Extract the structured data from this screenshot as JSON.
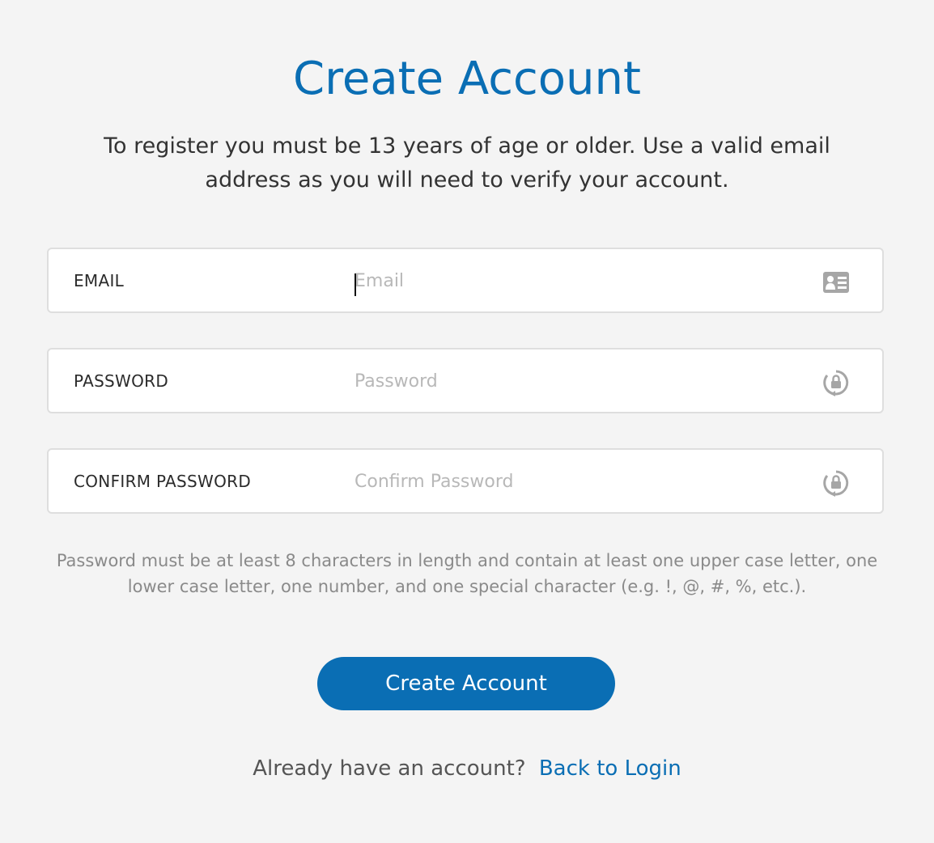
{
  "page": {
    "title": "Create Account",
    "intro": "To register you must be 13 years of age or older. Use a valid email address as you will need to verify your account."
  },
  "form": {
    "fields": [
      {
        "label": "EMAIL",
        "placeholder": "Email",
        "value": "",
        "icon": "id-card-icon",
        "focused": true
      },
      {
        "label": "PASSWORD",
        "placeholder": "Password",
        "value": "",
        "icon": "lock-refresh-icon",
        "focused": false
      },
      {
        "label": "CONFIRM PASSWORD",
        "placeholder": "Confirm Password",
        "value": "",
        "icon": "lock-refresh-icon",
        "focused": false
      }
    ],
    "password_hint": "Password must be at least 8 characters in length and contain at least one upper case letter, one lower case letter, one number, and one special character (e.g. !, @, #, %, etc.).",
    "submit_label": "Create Account"
  },
  "footer": {
    "question": "Already have an account?",
    "link_label": "Back to Login"
  },
  "colors": {
    "accent": "#0a6eb4",
    "background": "#f4f4f4",
    "field_border": "#dedede",
    "placeholder": "#b8b8b8",
    "hint_text": "#8a8a8a"
  }
}
